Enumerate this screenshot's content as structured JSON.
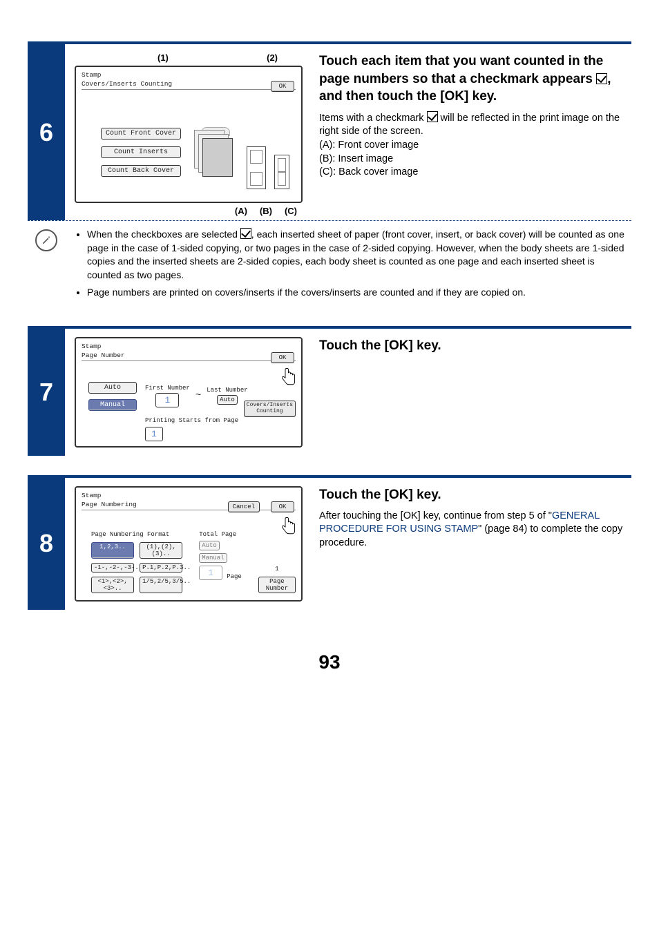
{
  "page_number": "93",
  "step6": {
    "num": "6",
    "markers": {
      "m1": "(1)",
      "m2": "(2)",
      "ma": "(A)",
      "mb": "(B)",
      "mc": "(C)"
    },
    "lcd": {
      "crumb": "Stamp",
      "title": "Covers/Inserts Counting",
      "ok": "OK",
      "btn_front": "Count Front Cover",
      "btn_inserts": "Count Inserts",
      "btn_back": "Count Back Cover"
    },
    "headline_p1": "Touch each item that you want counted in the page numbers so that a checkmark appears ",
    "headline_p2": ", and then touch the [OK] key.",
    "body1": "Items with a checkmark ",
    "body2": " will be reflected in the print image on the right side of the screen.",
    "line_a": "(A): Front cover image",
    "line_b": "(B): Insert image",
    "line_c": "(C): Back cover image",
    "note1a": "When the checkboxes are selected ",
    "note1b": ", each inserted sheet of paper (front cover, insert, or back cover) will be counted as one page in the case of 1-sided copying, or two pages in the case of 2-sided copying. However, when the body sheets are 1-sided copies and the inserted sheets are 2-sided copies, each body sheet is counted as one page and each inserted sheet is counted as two pages.",
    "note2": "Page numbers are printed on covers/inserts if the covers/inserts are counted and if they are copied on."
  },
  "step7": {
    "num": "7",
    "lcd": {
      "crumb": "Stamp",
      "title": "Page Number",
      "ok": "OK",
      "auto": "Auto",
      "manual": "Manual",
      "first_lbl": "First Number",
      "last_lbl": "Last Number",
      "first_val": "1",
      "last_val": "Auto",
      "tilde": "~",
      "covers_btn": "Covers/Inserts\nCounting",
      "start_lbl": "Printing Starts from Page",
      "start_val": "1"
    },
    "headline": "Touch the [OK] key."
  },
  "step8": {
    "num": "8",
    "lcd": {
      "crumb": "Stamp",
      "title": "Page Numbering",
      "ok": "OK",
      "cancel": "Cancel",
      "fmt_header": "Page Numbering Format",
      "fmt": [
        "1,2,3..",
        "(1),(2),(3)..",
        "-1-,-2-,-3-..",
        "P.1,P.2,P.3..",
        "<1>,<2>,<3>..",
        "1/5,2/5,3/5.."
      ],
      "tot_header": "Total Page",
      "tot_auto": "Auto",
      "tot_manual": "Manual",
      "tot_val": "1",
      "tot_unit": "Page",
      "tot_row_val": "1",
      "pagenum_btn": "Page Number"
    },
    "headline": "Touch the [OK] key.",
    "body_p1": "After touching the [OK] key, continue from step 5 of \"",
    "body_link": "GENERAL PROCEDURE FOR USING STAMP",
    "body_p2": "\" (page 84) to complete the copy procedure."
  }
}
